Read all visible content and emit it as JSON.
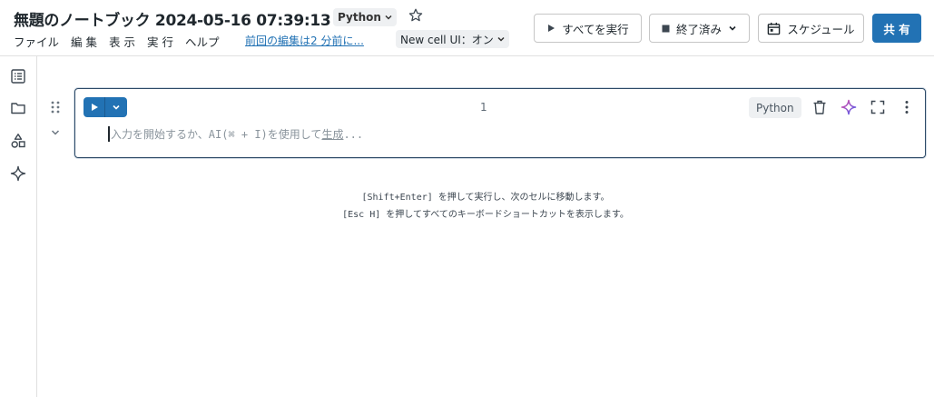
{
  "header": {
    "title": "無題のノートブック 2024-05-16 07:39:13",
    "language": "Python",
    "menu": [
      "ファイル",
      "編 集",
      "表 示",
      "実 行",
      "ヘルプ"
    ],
    "last_edit": "前回の編集は2 分前に...",
    "new_cell_ui": "New cell UI：オン"
  },
  "toolbar": {
    "run_all": "すべてを実行",
    "status": "終了済み",
    "schedule": "スケジュール",
    "share": "共 有"
  },
  "cell": {
    "number": "1",
    "language": "Python",
    "placeholder_prefix": "入力を開始するか、AI(⌘ + I)を使用して",
    "placeholder_link": "生成",
    "placeholder_suffix": "..."
  },
  "hints": {
    "line1": "[Shift+Enter] を押して実行し、次のセルに移動します。",
    "line2": "[Esc H] を押してすべてのキーボードショートカットを表示します。"
  },
  "colors": {
    "accent": "#2272b4",
    "ai_gradient_start": "#e04fa4",
    "ai_gradient_end": "#4a5cf0"
  },
  "icons": {
    "sidebar": [
      "table-of-contents-icon",
      "folder-icon",
      "shapes-icon",
      "sparkle-icon"
    ]
  }
}
